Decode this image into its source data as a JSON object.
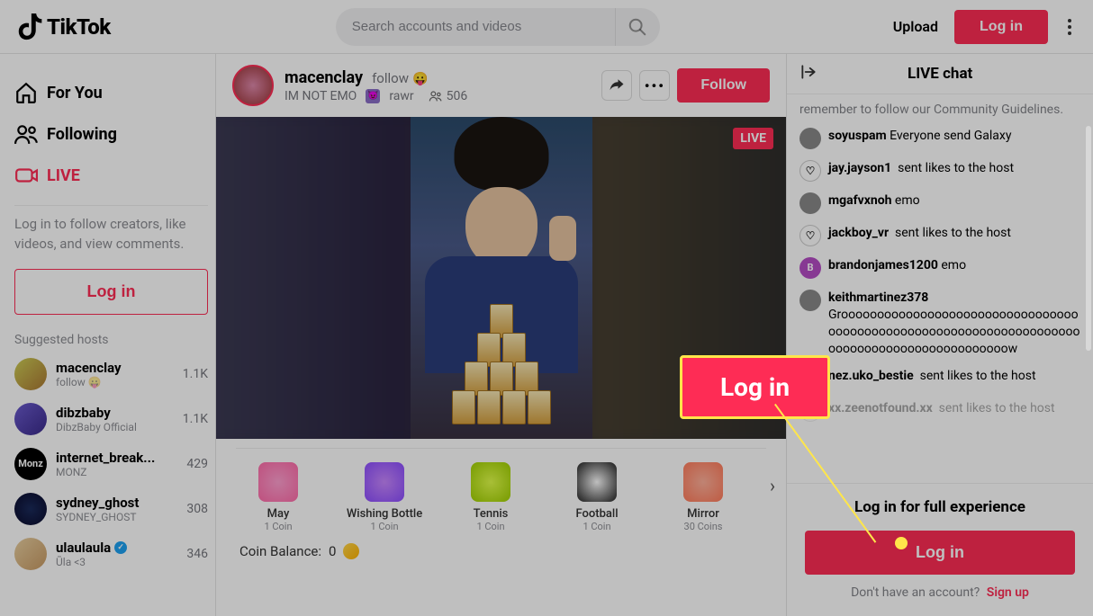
{
  "colors": {
    "accent": "#fe2c55",
    "highlight": "#ffe64a"
  },
  "header": {
    "brand": "TikTok",
    "search_placeholder": "Search accounts and videos",
    "upload_label": "Upload",
    "login_label": "Log in"
  },
  "sidebar": {
    "nav": {
      "for_you": "For You",
      "following": "Following",
      "live": "LIVE"
    },
    "login_prompt": "Log in to follow creators, like videos, and view comments.",
    "login_label": "Log in",
    "suggested_label": "Suggested hosts",
    "hosts": [
      {
        "name": "macenclay",
        "sub": "follow 😛",
        "count": "1.1K"
      },
      {
        "name": "dibzbaby",
        "sub": "DibzBaby Official",
        "count": "1.1K"
      },
      {
        "name": "internet_break...",
        "sub": "MONZ",
        "count": "429"
      },
      {
        "name": "sydney_ghost",
        "sub": "SYDNEY_GHOST",
        "count": "308"
      },
      {
        "name": "ulaulaula",
        "sub": "Ūla <3",
        "count": "346",
        "verified": true
      }
    ]
  },
  "live": {
    "username": "macenclay",
    "follow_text": "follow",
    "emoji": "😛",
    "tagline": "IM NOT EMO",
    "tagword": "rawr",
    "viewer_count": "506",
    "follow_button": "Follow",
    "live_badge": "LIVE"
  },
  "gifts": [
    {
      "name": "May",
      "cost": "1 Coin"
    },
    {
      "name": "Wishing Bottle",
      "cost": "1 Coin"
    },
    {
      "name": "Tennis",
      "cost": "1 Coin"
    },
    {
      "name": "Football",
      "cost": "1 Coin"
    },
    {
      "name": "Mirror",
      "cost": "30 Coins"
    }
  ],
  "coin_balance_label": "Coin Balance:",
  "coin_balance_value": "0",
  "chat": {
    "title": "LIVE chat",
    "system_msg": "remember to follow our Community Guidelines.",
    "messages": [
      {
        "user": "soyuspam",
        "text": "Everyone send Galaxy",
        "avatar": "av"
      },
      {
        "user": "jay.jayson1",
        "text": "sent likes to the host",
        "avatar": "heart"
      },
      {
        "user": "mgafvxnoh",
        "text": "emo",
        "avatar": "av"
      },
      {
        "user": "jackboy_vr",
        "text": "sent likes to the host",
        "avatar": "heart"
      },
      {
        "user": "brandonjames1200",
        "text": "emo",
        "avatar": "b"
      },
      {
        "user": "keithmartinez378",
        "text": "Grooooooooooooooooooooooooooooooooooooooooooooooooooooooooooooooooooooooooooooooooooooooooooooow",
        "avatar": "av"
      },
      {
        "user": "nez.uko_bestie",
        "text": "sent likes to the host",
        "avatar": "heart"
      },
      {
        "user": "xx.zeenotfound.xx",
        "text": "sent likes to the host",
        "avatar": "heart",
        "faded": true
      }
    ],
    "cta_title": "Log in for full experience",
    "cta_login": "Log in",
    "cta_signup_prompt": "Don't have an account?",
    "cta_signup_link": "Sign up"
  },
  "callout": {
    "label": "Log in"
  }
}
